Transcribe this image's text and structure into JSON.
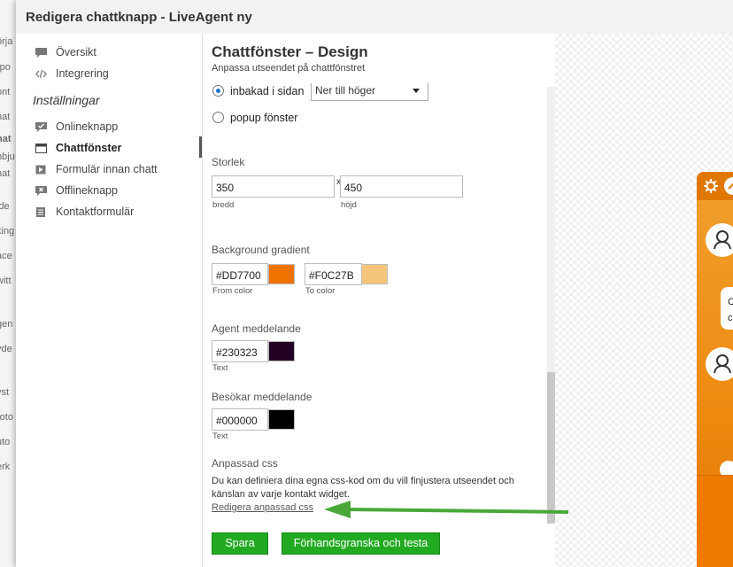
{
  "window": {
    "title": "Redigera chattknapp - LiveAgent ny"
  },
  "bg_fragments": [
    "örja",
    "-po",
    "ont",
    "hat",
    "hat",
    "nbju",
    "hat",
    "ide",
    "king",
    "ace",
    "witt",
    "gen",
    "vde",
    "yst",
    "roto",
    "uto",
    "erk"
  ],
  "sidebar": {
    "top_items": [
      {
        "label": "Översikt",
        "icon": "comment-icon"
      },
      {
        "label": "Integrering",
        "icon": "code-icon"
      }
    ],
    "section_title": "Inställningar",
    "items": [
      {
        "label": "Onlineknapp",
        "icon": "chat-check-icon"
      },
      {
        "label": "Chattfönster",
        "icon": "window-icon",
        "active": true
      },
      {
        "label": "Formulär innan chatt",
        "icon": "play-icon"
      },
      {
        "label": "Offlineknapp",
        "icon": "chat-x-icon"
      },
      {
        "label": "Kontaktformulär",
        "icon": "form-icon"
      }
    ]
  },
  "main": {
    "title": "Chattfönster – Design",
    "subtitle": "Anpassa utseendet på chattfönstret",
    "embed": {
      "inline_label": "inbakad i sidan",
      "position_value": "Ner till höger",
      "popup_label": "popup fönster",
      "selected": "inline"
    },
    "size": {
      "title": "Storlek",
      "width": "350",
      "separator": "x",
      "height": "450",
      "width_label": "bredd",
      "height_label": "höjd"
    },
    "gradient": {
      "title": "Background gradient",
      "from_value": "#DD7700",
      "from_label": "From color",
      "to_value": "#F0C27B",
      "to_label": "To color"
    },
    "agent_message": {
      "title": "Agent meddelande",
      "value": "#230323",
      "label": "Text"
    },
    "visitor_message": {
      "title": "Besökar meddelande",
      "value": "#000000",
      "label": "Text"
    },
    "custom_css": {
      "title": "Anpassad css",
      "description": "Du kan definiera dina egna css-kod om du vill finjustera utseendet och känslan av varje kontakt widget.",
      "link": "Redigera anpassad css"
    },
    "buttons": {
      "save": "Spara",
      "preview": "Förhandsgranska och testa"
    }
  },
  "preview": {
    "bubble_lines": [
      "C",
      "c"
    ]
  },
  "colors": {
    "accent_green": "#22aa22",
    "arrow_green": "#4aa83a",
    "gradient_from": "#DD7700",
    "gradient_to": "#F0C27B",
    "agent_text": "#230323",
    "visitor_text": "#000000"
  }
}
